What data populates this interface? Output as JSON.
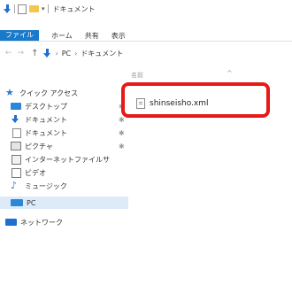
{
  "window": {
    "title": "ドキュメント",
    "title_separator": "|"
  },
  "ribbon": {
    "tabs": [
      "ファイル",
      "ホーム",
      "共有",
      "表示"
    ]
  },
  "address_bar": {
    "path": [
      "PC",
      "ドキュメント"
    ]
  },
  "columns": {
    "name": "名前"
  },
  "navigation": {
    "quick_access": "クイック アクセス",
    "items": [
      {
        "label": "デスクトップ",
        "pinned": true
      },
      {
        "label": "ドキュメント",
        "pinned": true
      },
      {
        "label": "ドキュメント",
        "pinned": true
      },
      {
        "label": "ピクチャ",
        "pinned": true
      },
      {
        "label": "インターネットファイルサ",
        "pinned": false
      },
      {
        "label": "ビデオ",
        "pinned": false
      },
      {
        "label": "ミュージック",
        "pinned": false
      }
    ],
    "pc": "PC",
    "network": "ネットワーク"
  },
  "files": [
    {
      "name": "shinseisho.xml"
    }
  ],
  "colors": {
    "file_tab": "#1979ca",
    "highlight": "#e81919",
    "selection": "#ddeaf8"
  }
}
